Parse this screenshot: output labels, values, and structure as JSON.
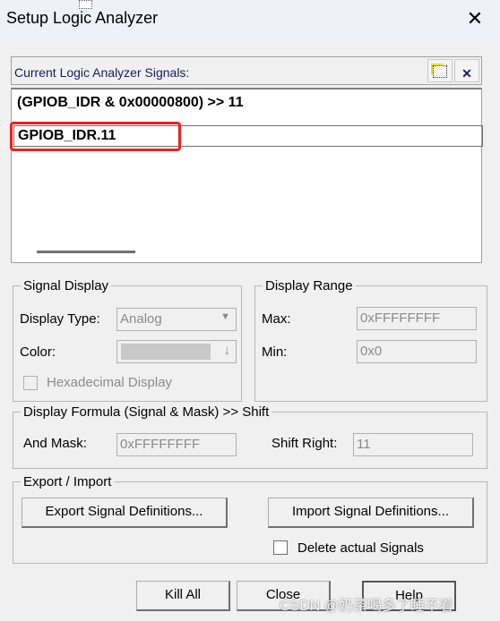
{
  "window": {
    "title": "Setup Logic Analyzer",
    "close": "✕"
  },
  "signals": {
    "header": "Current Logic Analyzer Signals:",
    "items": [
      "(GPIOB_IDR & 0x00000800) >> 11"
    ],
    "edit_value": "GPIOB_IDR.11",
    "new_icon": "new-item-icon",
    "delete_icon": "delete-icon"
  },
  "signal_display": {
    "legend": "Signal Display",
    "type_label": "Display Type:",
    "type_value": "Analog",
    "color_label": "Color:",
    "hex_label": "Hexadecimal Display"
  },
  "display_range": {
    "legend": "Display Range",
    "max_label": "Max:",
    "max_value": "0xFFFFFFFF",
    "min_label": "Min:",
    "min_value": "0x0"
  },
  "formula": {
    "legend": "Display Formula (Signal & Mask) >> Shift",
    "mask_label": "And Mask:",
    "mask_value": "0xFFFFFFFF",
    "shift_label": "Shift Right:",
    "shift_value": "11"
  },
  "export_import": {
    "legend": "Export / Import",
    "export_btn": "Export Signal Definitions...",
    "import_btn": "Import Signal Definitions...",
    "delete_label": "Delete actual Signals"
  },
  "buttons": {
    "kill_all": "Kill All",
    "close": "Close",
    "help": "Help"
  },
  "watermark": "CSDN @奶茶喝多了睡不着",
  "colors": {
    "highlight": "#f02020"
  }
}
